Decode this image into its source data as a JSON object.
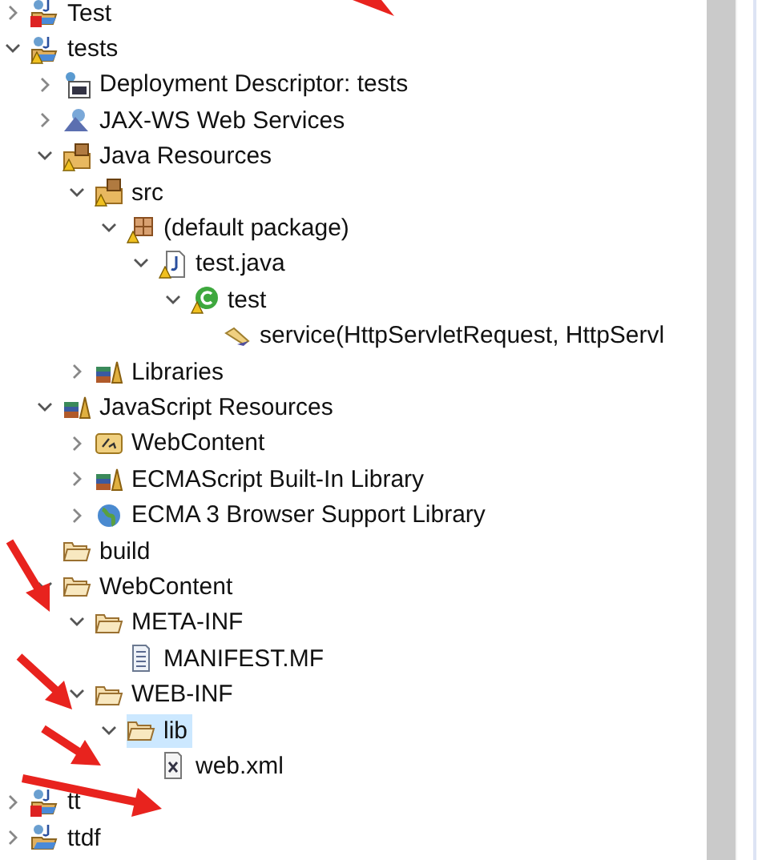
{
  "tree": [
    {
      "label": "Test",
      "kind": "project",
      "error": true,
      "warning": false,
      "expanded": false,
      "selected": false
    },
    {
      "label": "tests",
      "kind": "project",
      "error": false,
      "warning": true,
      "expanded": true,
      "selected": false,
      "children": [
        {
          "label": "Deployment Descriptor: tests",
          "kind": "deployment",
          "error": false,
          "warning": false,
          "expanded": false,
          "selected": false
        },
        {
          "label": "JAX-WS Web Services",
          "kind": "webservice",
          "error": false,
          "warning": false,
          "expanded": false,
          "selected": false
        },
        {
          "label": "Java Resources",
          "kind": "java-resources",
          "error": false,
          "warning": true,
          "expanded": true,
          "selected": false,
          "children": [
            {
              "label": "src",
              "kind": "source-folder",
              "error": false,
              "warning": true,
              "expanded": true,
              "selected": false,
              "children": [
                {
                  "label": "(default package)",
                  "kind": "package",
                  "error": false,
                  "warning": true,
                  "expanded": true,
                  "selected": false,
                  "children": [
                    {
                      "label": "test.java",
                      "kind": "java-file",
                      "error": false,
                      "warning": true,
                      "expanded": true,
                      "selected": false,
                      "children": [
                        {
                          "label": "test",
                          "kind": "class",
                          "error": false,
                          "warning": true,
                          "expanded": true,
                          "selected": false,
                          "children": [
                            {
                              "label": "service(HttpServletRequest, HttpServl",
                              "kind": "method",
                              "error": false,
                              "warning": false,
                              "selected": false
                            }
                          ]
                        }
                      ]
                    }
                  ]
                }
              ]
            },
            {
              "label": "Libraries",
              "kind": "library",
              "error": false,
              "warning": false,
              "expanded": false,
              "selected": false
            }
          ]
        },
        {
          "label": "JavaScript Resources",
          "kind": "library",
          "error": false,
          "warning": false,
          "expanded": true,
          "selected": false,
          "children": [
            {
              "label": "WebContent",
              "kind": "js-folder",
              "error": false,
              "warning": false,
              "expanded": false,
              "selected": false
            },
            {
              "label": "ECMAScript Built-In Library",
              "kind": "library",
              "error": false,
              "warning": false,
              "expanded": false,
              "selected": false
            },
            {
              "label": "ECMA 3 Browser Support Library",
              "kind": "globe",
              "error": false,
              "warning": false,
              "expanded": false,
              "selected": false
            }
          ]
        },
        {
          "label": "build",
          "kind": "folder",
          "error": false,
          "warning": false,
          "selected": false
        },
        {
          "label": "WebContent",
          "kind": "folder",
          "error": false,
          "warning": false,
          "expanded": true,
          "selected": false,
          "children": [
            {
              "label": "META-INF",
              "kind": "folder",
              "error": false,
              "warning": false,
              "expanded": true,
              "selected": false,
              "children": [
                {
                  "label": "MANIFEST.MF",
                  "kind": "text-file",
                  "error": false,
                  "warning": false,
                  "selected": false
                }
              ]
            },
            {
              "label": "WEB-INF",
              "kind": "folder",
              "error": false,
              "warning": false,
              "expanded": true,
              "selected": false,
              "children": [
                {
                  "label": "lib",
                  "kind": "folder",
                  "error": false,
                  "warning": false,
                  "expanded": true,
                  "selected": true,
                  "children": [
                    {
                      "label": "web.xml",
                      "kind": "xml-file",
                      "error": false,
                      "warning": false,
                      "selected": false
                    }
                  ]
                }
              ]
            }
          ]
        }
      ]
    },
    {
      "label": "tt",
      "kind": "project",
      "error": true,
      "warning": false,
      "expanded": false,
      "selected": false
    },
    {
      "label": "ttdf",
      "kind": "project",
      "error": false,
      "warning": false,
      "expanded": false,
      "selected": false
    }
  ]
}
